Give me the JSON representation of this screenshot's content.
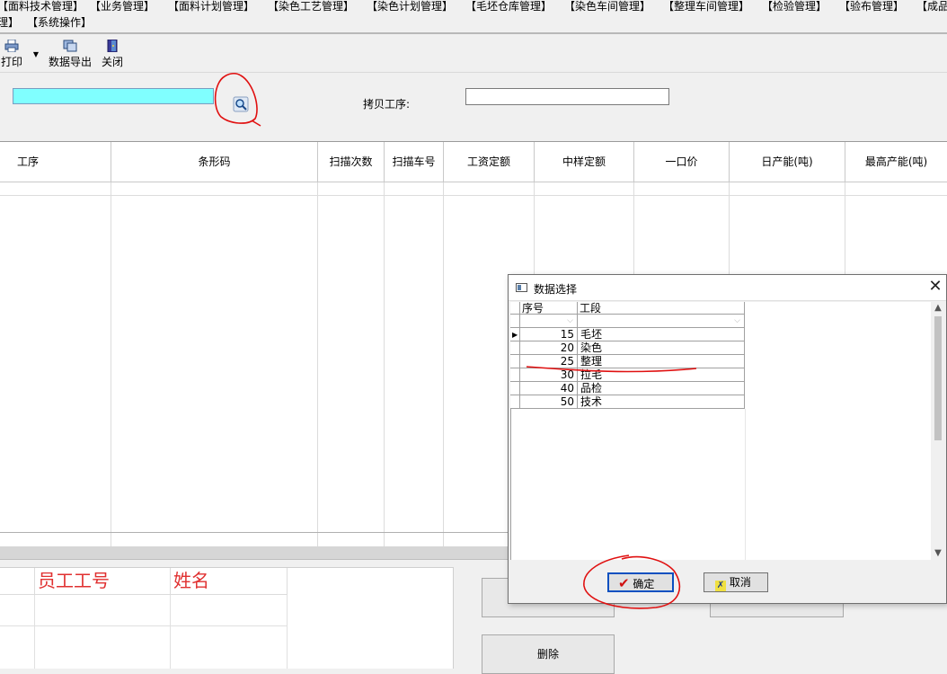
{
  "menu": {
    "row1": [
      "【面料技术管理】",
      "【业务管理】",
      "【面料计划管理】",
      "【染色工艺管理】",
      "【染色计划管理】",
      "【毛坯仓库管理】",
      "【染色车间管理】",
      "【整理车间管理】",
      "【检验管理】",
      "【验布管理】",
      "【成品"
    ],
    "row2": [
      "理】",
      "【系统操作】"
    ]
  },
  "toolbar": {
    "print_label": "打印",
    "export_label": "数据导出",
    "close_label": "关闭"
  },
  "filter": {
    "copy_process_label": "拷贝工序:",
    "process_value": "",
    "copy_process_value": ""
  },
  "grid": {
    "columns": [
      "工序",
      "条形码",
      "扫描次数",
      "扫描车号",
      "工资定额",
      "中样定额",
      "一口价",
      "日产能(吨)",
      "最高产能(吨)"
    ]
  },
  "employees": {
    "columns": [
      "员工工号",
      "姓名"
    ]
  },
  "buttons": {
    "delete_label": "删除"
  },
  "dialog": {
    "title": "数据选择",
    "close_glyph": "✕",
    "columns": [
      "序号",
      "工段"
    ],
    "rows": [
      {
        "no": "15",
        "section": "毛坯"
      },
      {
        "no": "20",
        "section": "染色"
      },
      {
        "no": "25",
        "section": "整理"
      },
      {
        "no": "30",
        "section": "拉毛"
      },
      {
        "no": "40",
        "section": "品检"
      },
      {
        "no": "50",
        "section": "技术"
      }
    ],
    "ok_label": "确定",
    "cancel_label": "取消"
  },
  "colors": {
    "highlight_input": "#80ffff",
    "annotation_red": "#e01010",
    "employee_header": "#e03030"
  }
}
